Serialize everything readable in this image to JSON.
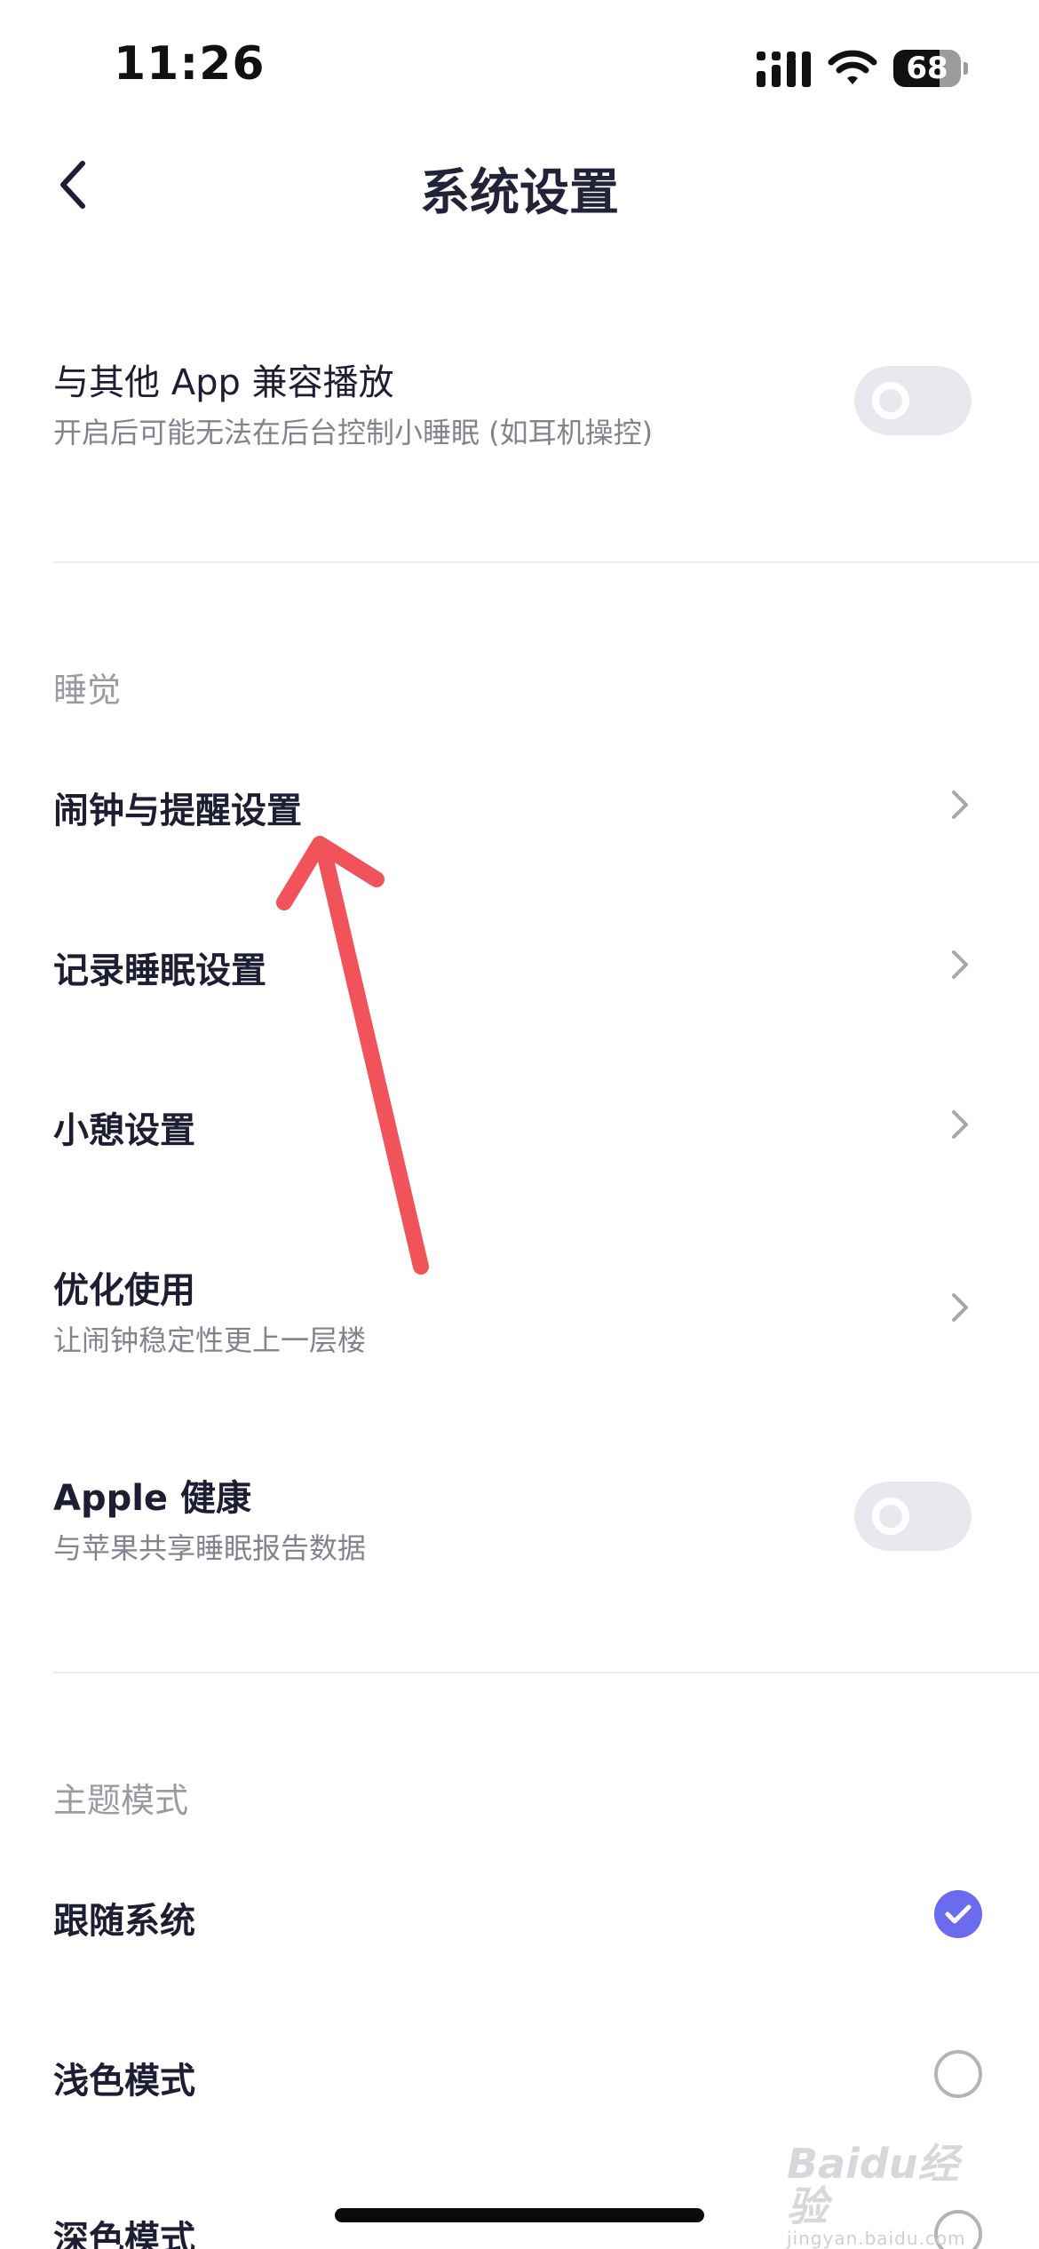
{
  "status_bar": {
    "time": "11:26",
    "battery_level": "68",
    "battery_fraction": 0.68
  },
  "header": {
    "title": "系统设置",
    "back_icon": "chevron-left-icon"
  },
  "compat_row": {
    "title": "与其他 App 兼容播放",
    "subtitle": "开启后可能无法在后台控制小睡眠 (如耳机操控)",
    "toggle_on": false
  },
  "sleep_section": {
    "title": "睡觉",
    "items": [
      {
        "label": "闹钟与提醒设置",
        "icon": "chevron-right-icon"
      },
      {
        "label": "记录睡眠设置",
        "icon": "chevron-right-icon"
      },
      {
        "label": "小憩设置",
        "icon": "chevron-right-icon"
      },
      {
        "label": "优化使用",
        "subtitle": "让闹钟稳定性更上一层楼",
        "icon": "chevron-right-icon"
      }
    ]
  },
  "health_row": {
    "title": "Apple 健康",
    "subtitle": "与苹果共享睡眠报告数据",
    "toggle_on": false
  },
  "theme_section": {
    "title": "主题模式",
    "options": [
      {
        "label": "跟随系统",
        "selected": true
      },
      {
        "label": "浅色模式",
        "selected": false
      },
      {
        "label": "深色模式",
        "selected": false
      }
    ]
  },
  "watermark": {
    "brand": "Baidu经验",
    "url": "jingyan.baidu.com"
  },
  "colors": {
    "accent": "#6b6bef",
    "annotation_arrow": "#f0545a",
    "text_primary": "#1d1d33",
    "text_secondary": "#83838f"
  }
}
